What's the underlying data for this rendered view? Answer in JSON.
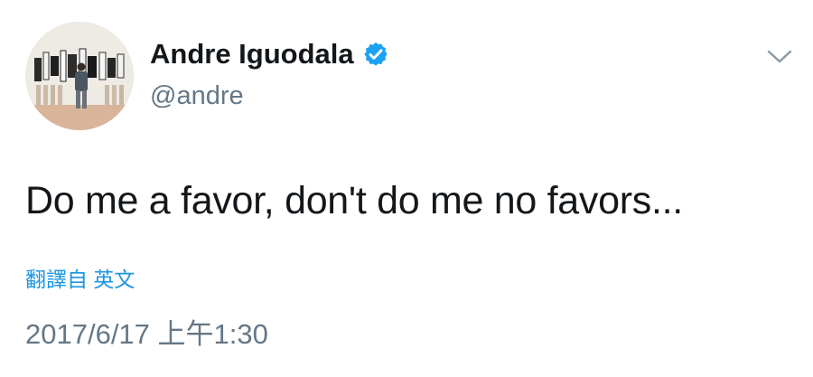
{
  "tweet": {
    "author": {
      "display_name": "Andre Iguodala",
      "handle": "@andre",
      "verified": true,
      "verified_color": "#1da1f2",
      "avatar_icon": "avatar-gallery-photo"
    },
    "menu_icon": "chevron-down-icon",
    "text": "Do me a favor, don't do me no favors...",
    "translate_label": "翻譯自 英文",
    "timestamp": "2017/6/17 上午1:30"
  },
  "colors": {
    "text_primary": "#14171a",
    "text_secondary": "#657786",
    "link": "#1b95e0",
    "verified": "#1da1f2"
  }
}
